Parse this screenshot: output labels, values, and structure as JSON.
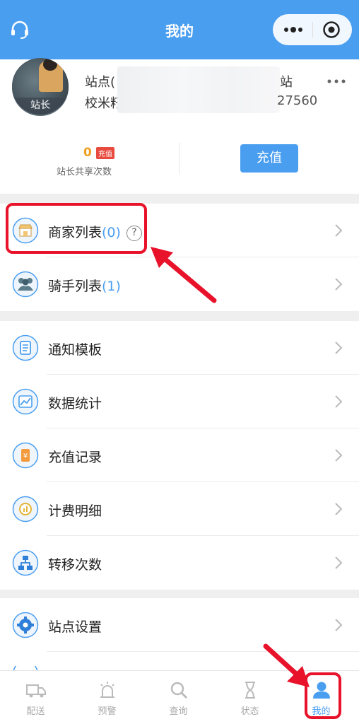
{
  "header": {
    "title": "我的"
  },
  "profile": {
    "station_prefix": "站点(",
    "station_suffix": "站",
    "school_prefix": "校米籽",
    "phone_suffix": "27560",
    "avatar_badge": "站长",
    "share_count": "0",
    "share_count_tag": "充值",
    "share_label": "站长共享次数",
    "recharge_button": "充值"
  },
  "menu": {
    "group1": [
      {
        "label": "商家列表",
        "count": "(0)",
        "has_help": true,
        "help_symbol": "?",
        "icon": "shop-icon"
      },
      {
        "label": "骑手列表",
        "count": "(1)",
        "icon": "riders-icon"
      }
    ],
    "group2": [
      {
        "label": "通知模板",
        "icon": "notice-template-icon"
      },
      {
        "label": "数据统计",
        "icon": "chart-icon"
      },
      {
        "label": "充值记录",
        "icon": "recharge-record-icon"
      },
      {
        "label": "计费明细",
        "icon": "billing-icon"
      },
      {
        "label": "转移次数",
        "icon": "transfer-icon"
      }
    ],
    "group3": [
      {
        "label": "站点设置",
        "icon": "gear-icon"
      }
    ]
  },
  "tabbar": [
    {
      "label": "配送",
      "icon": "truck-icon",
      "active": false
    },
    {
      "label": "预警",
      "icon": "alarm-icon",
      "active": false
    },
    {
      "label": "查询",
      "icon": "search-icon",
      "active": false
    },
    {
      "label": "状态",
      "icon": "hourglass-icon",
      "active": false
    },
    {
      "label": "我的",
      "icon": "user-icon",
      "active": true
    }
  ],
  "colors": {
    "primary": "#4a9ef0",
    "accent_orange": "#f0a020",
    "annotation_red": "#e8122a"
  }
}
